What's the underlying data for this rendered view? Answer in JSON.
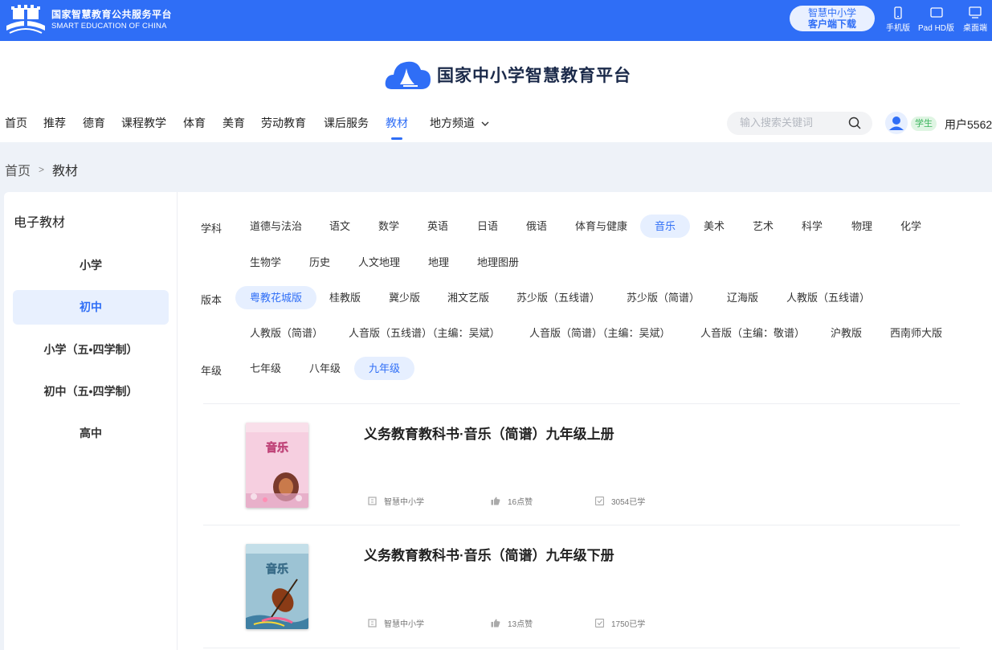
{
  "topbar": {
    "brand_cn": "国家智慧教育公共服务平台",
    "brand_en": "SMART EDUCATION OF CHINA",
    "download_line1": "智慧中小学",
    "download_line2": "客户端下载",
    "devices": [
      {
        "label": "手机版",
        "icon": "phone-icon"
      },
      {
        "label": "Pad HD版",
        "icon": "tablet-icon"
      },
      {
        "label": "桌面端",
        "icon": "desktop-icon"
      }
    ],
    "color": "#2f6ef6"
  },
  "header": {
    "platform_title": "国家中小学智慧教育平台",
    "nav": [
      "首页",
      "推荐",
      "德育",
      "课程教学",
      "体育",
      "美育",
      "劳动教育",
      "课后服务",
      "教材",
      "地方频道"
    ],
    "nav_active": "教材",
    "search_placeholder": "输入搜索关键词",
    "role_badge": "学生",
    "username": "用户5562"
  },
  "breadcrumb": {
    "home": "首页",
    "separator": ">",
    "current": "教材"
  },
  "sidebar": {
    "title": "电子教材",
    "items": [
      "小学",
      "初中",
      "小学（五•四学制）",
      "初中（五•四学制）",
      "高中"
    ],
    "active": "初中"
  },
  "filters": {
    "subject_label": "学科",
    "subjects": [
      "道德与法治",
      "语文",
      "数学",
      "英语",
      "日语",
      "俄语",
      "体育与健康",
      "音乐",
      "美术",
      "艺术",
      "科学",
      "物理",
      "化学",
      "生物学",
      "历史",
      "人文地理",
      "地理",
      "地理图册"
    ],
    "subject_active": "音乐",
    "edition_label": "版本",
    "editions": [
      "粤教花城版",
      "桂教版",
      "冀少版",
      "湘文艺版",
      "苏少版（五线谱）",
      "苏少版（简谱）",
      "辽海版",
      "人教版（五线谱）",
      "人教版（简谱）",
      "人音版（五线谱）（主编：吴斌）",
      "人音版（简谱）（主编：吴斌）",
      "人音版（主编：敬谱）",
      "沪教版",
      "西南师大版"
    ],
    "edition_active": "粤教花城版",
    "grade_label": "年级",
    "grades": [
      "七年级",
      "八年级",
      "九年级"
    ],
    "grade_active": "九年级"
  },
  "books": [
    {
      "title": "义务教育教科书·音乐（简谱）九年级上册",
      "cover_title": "音乐",
      "source": "智慧中小学",
      "likes": "16点赞",
      "learners": "3054已学"
    },
    {
      "title": "义务教育教科书·音乐（简谱）九年级下册",
      "cover_title": "音乐",
      "source": "智慧中小学",
      "likes": "13点赞",
      "learners": "1750已学"
    }
  ]
}
